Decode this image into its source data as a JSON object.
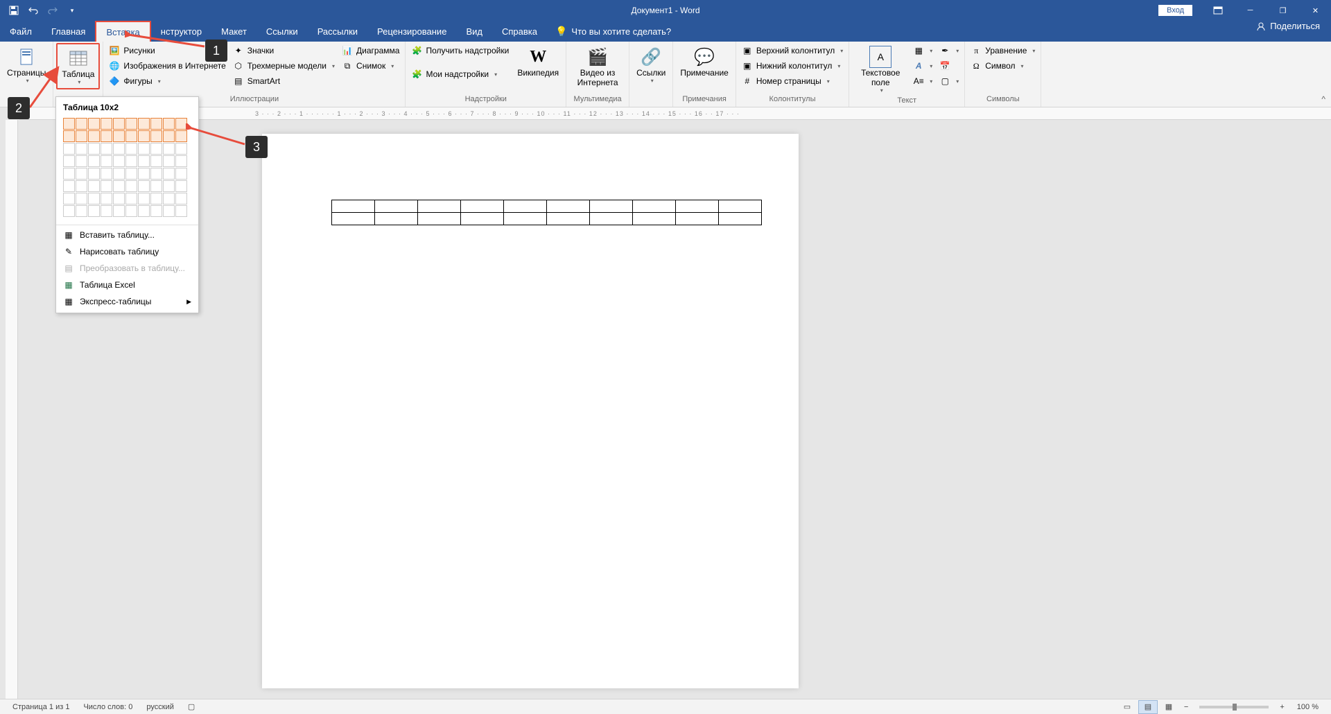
{
  "title": "Документ1 - Word",
  "login": "Вход",
  "tabs": {
    "file": "Файл",
    "home": "Главная",
    "insert": "Вставка",
    "design": "нструктор",
    "layout": "Макет",
    "references": "Ссылки",
    "mailings": "Рассылки",
    "review": "Рецензирование",
    "view": "Вид",
    "help": "Справка",
    "tellme": "Что вы хотите сделать?",
    "share": "Поделиться"
  },
  "ribbon": {
    "pages": {
      "btn": "Страницы"
    },
    "tables": {
      "btn": "Таблица"
    },
    "illustrations": {
      "label": "Иллюстрации",
      "pictures": "Рисунки",
      "online_pics": "Изображения в Интернете",
      "shapes": "Фигуры",
      "icons": "Значки",
      "models3d": "Трехмерные модели",
      "smartart": "SmartArt",
      "chart": "Диаграмма",
      "screenshot": "Снимок"
    },
    "addins": {
      "label": "Надстройки",
      "get": "Получить надстройки",
      "my": "Мои надстройки",
      "wiki": "Википедия"
    },
    "media": {
      "label": "Мультимедиа",
      "video": "Видео из Интернета"
    },
    "links": {
      "label": "",
      "btn": "Ссылки"
    },
    "comments": {
      "label": "Примечания",
      "btn": "Примечание"
    },
    "headerfooter": {
      "label": "Колонтитулы",
      "header": "Верхний колонтитул",
      "footer": "Нижний колонтитул",
      "pagenum": "Номер страницы"
    },
    "text": {
      "label": "Текст",
      "textbox": "Текстовое поле"
    },
    "symbols": {
      "label": "Символы",
      "equation": "Уравнение",
      "symbol": "Символ"
    }
  },
  "table_menu": {
    "title": "Таблица 10x2",
    "insert": "Вставить таблицу...",
    "draw": "Нарисовать таблицу",
    "convert": "Преобразовать в таблицу...",
    "excel": "Таблица Excel",
    "quick": "Экспресс-таблицы"
  },
  "callouts": {
    "c1": "1",
    "c2": "2",
    "c3": "3"
  },
  "ruler": "3 · · · 2 · · · 1 · · ·   · · · 1 · · · 2 · · · 3 · · · 4 · · · 5 · · · 6 · · · 7 · · · 8 · · · 9 · · · 10 · · · 11 · · · 12 · · · 13 · · · 14 · · · 15 · · · 16 ·   · 17 · · ·",
  "status": {
    "page": "Страница 1 из 1",
    "words": "Число слов: 0",
    "lang": "русский",
    "zoom": "100 %"
  },
  "doc_table": {
    "rows": 2,
    "cols": 10
  },
  "grid_picker": {
    "rows": 8,
    "cols": 10,
    "sel_rows": 2,
    "sel_cols": 10
  }
}
